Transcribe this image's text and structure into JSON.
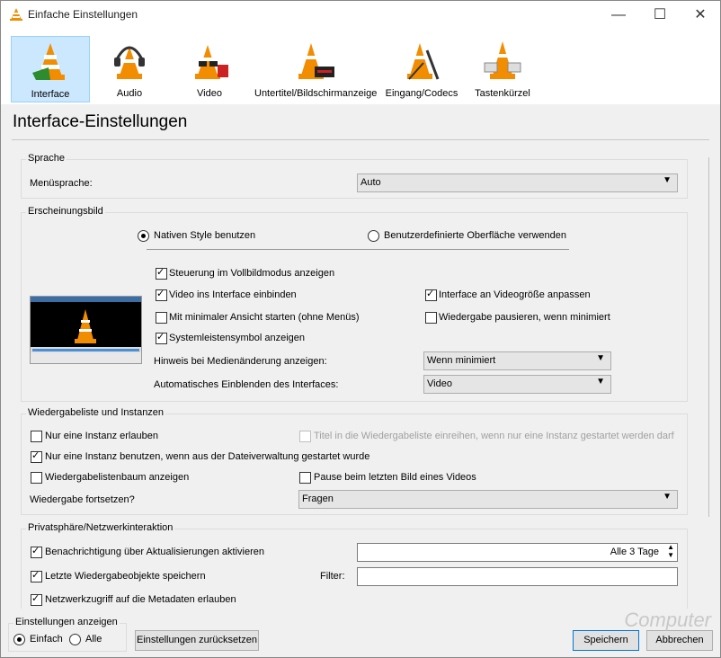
{
  "window": {
    "title": "Einfache Einstellungen",
    "controls": {
      "minimize": "—",
      "maximize": "☐",
      "close": "✕"
    }
  },
  "toolbar": {
    "items": [
      {
        "label": "Interface",
        "icon": "vlc-cone-interface-icon",
        "selected": true
      },
      {
        "label": "Audio",
        "icon": "vlc-cone-headphones-icon"
      },
      {
        "label": "Video",
        "icon": "vlc-cone-glasses-icon"
      },
      {
        "label": "Untertitel/Bildschirmanzeige",
        "icon": "vlc-cone-subtitle-icon"
      },
      {
        "label": "Eingang/Codecs",
        "icon": "vlc-cone-cable-icon"
      },
      {
        "label": "Tastenkürzel",
        "icon": "vlc-cone-hotkeys-icon"
      }
    ]
  },
  "heading": "Interface-Einstellungen",
  "sprache": {
    "title": "Sprache",
    "menu_label": "Menüsprache:",
    "menu_value": "Auto"
  },
  "erscheinungsbild": {
    "title": "Erscheinungsbild",
    "radio_native": "Nativen Style benutzen",
    "radio_custom": "Benutzerdefinierte Oberfläche verwenden",
    "cb_fullscreen": "Steuerung im Vollbildmodus anzeigen",
    "cb_embed": "Video ins Interface einbinden",
    "cb_resize": "Interface an Videogröße anpassen",
    "cb_minimal": "Mit minimaler Ansicht starten (ohne Menüs)",
    "cb_pause": "Wiedergabe pausieren, wenn minimiert",
    "cb_systray": "Systemleistensymbol anzeigen",
    "media_change_label": "Hinweis bei Medienänderung anzeigen:",
    "media_change_value": "Wenn minimiert",
    "autoshow_label": "Automatisches Einblenden des Interfaces:",
    "autoshow_value": "Video"
  },
  "wiedergabeliste": {
    "title": "Wiedergabeliste und Instanzen",
    "cb_multi": "Nur eine Instanz erlauben",
    "cb_enqueue": "Titel in die Wiedergabeliste einreihen, wenn nur eine Instanz gestartet werden darf",
    "cb_filemanager": "Nur eine Instanz benutzen, wenn aus der Dateiverwaltung gestartet wurde",
    "cb_tree": "Wiedergabelistenbaum anzeigen",
    "cb_lastframe": "Pause beim letzten Bild eines Videos",
    "resume_label": "Wiedergabe fortsetzen?",
    "resume_value": "Fragen"
  },
  "privat": {
    "title": "Privatsphäre/Netzwerkinteraktion",
    "cb_updates": "Benachrichtigung über Aktualisierungen aktivieren",
    "updates_value": "Alle 3 Tage",
    "cb_recent": "Letzte Wiedergabeobjekte speichern",
    "filter_label": "Filter:",
    "filter_value": "",
    "cb_metadata": "Netzwerkzugriff auf die Metadaten erlauben"
  },
  "footer": {
    "show_title": "Einstellungen anzeigen",
    "radio_simple": "Einfach",
    "radio_all": "Alle",
    "reset": "Einstellungen zurücksetzen",
    "save": "Speichern",
    "cancel": "Abbrechen",
    "watermark": "Computer"
  },
  "colors": {
    "selected_bg": "#cce8ff",
    "accent": "#0078d7",
    "cone": "#f28c00"
  }
}
